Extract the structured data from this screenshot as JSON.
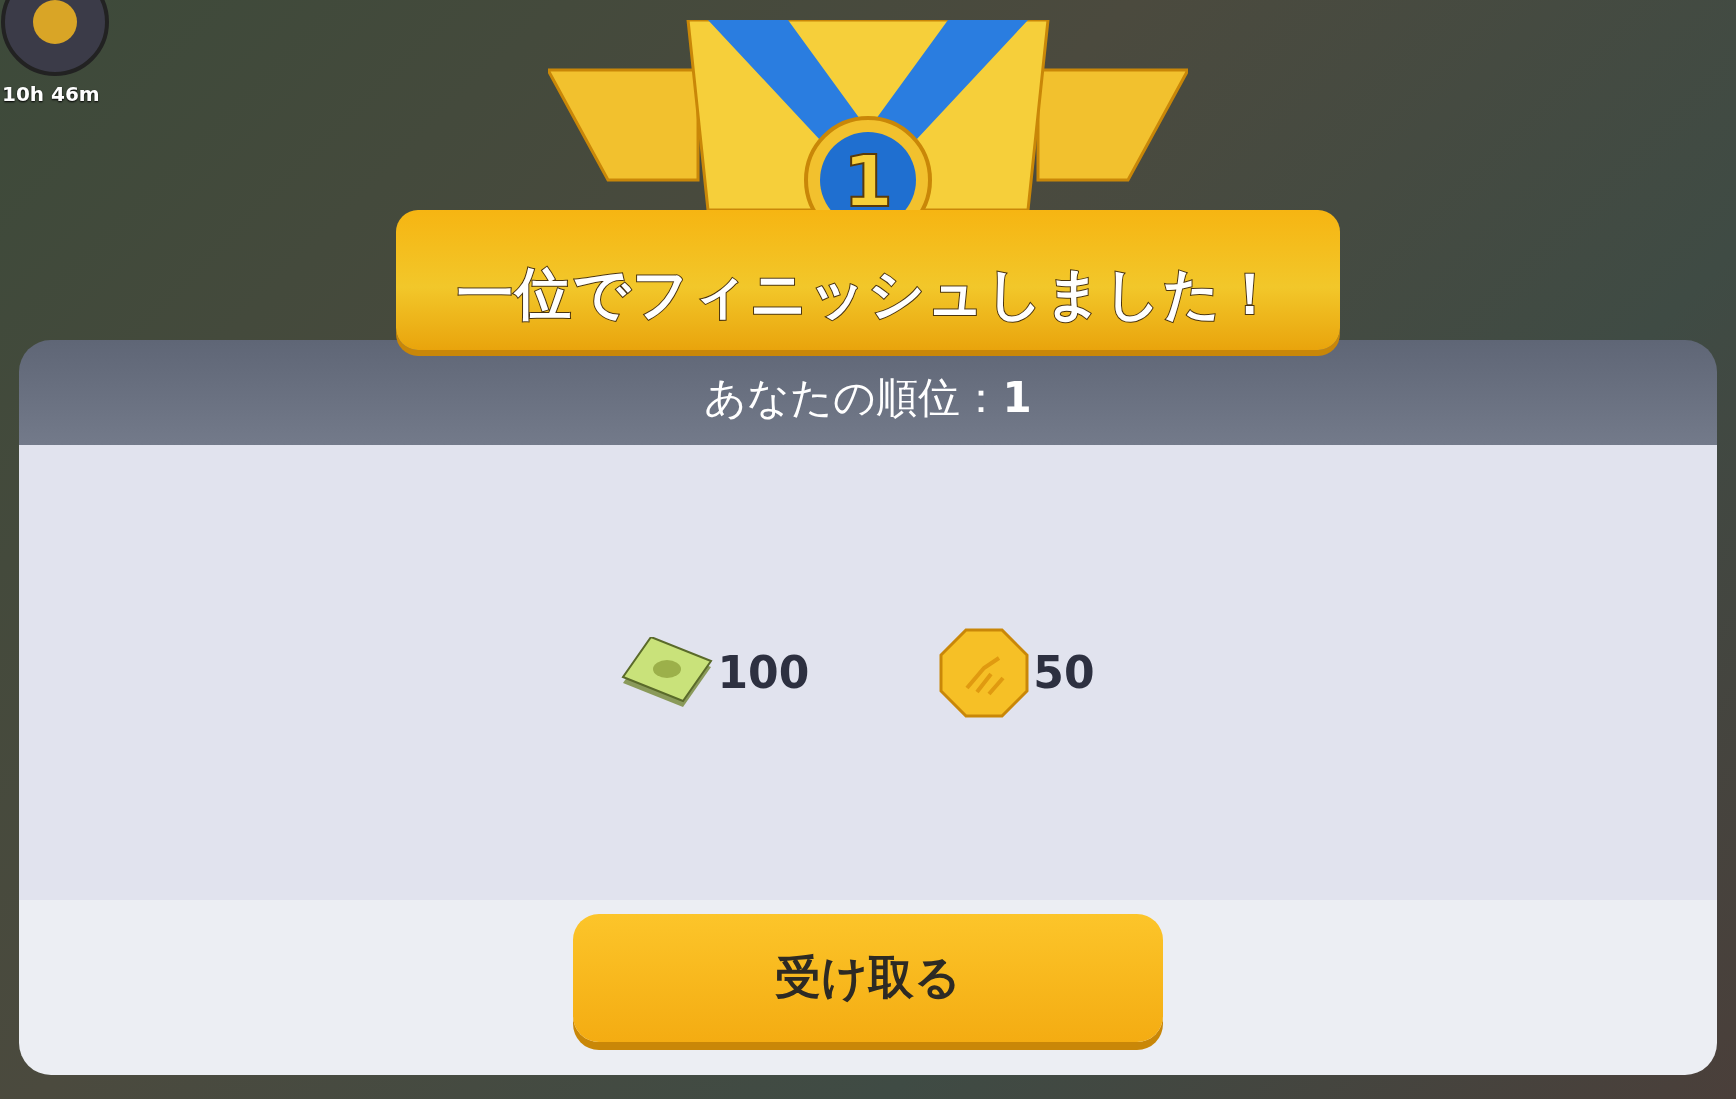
{
  "timer": {
    "text": "10h 46m"
  },
  "banner": {
    "title": "一位でフィニッシュしました！",
    "medal_number": "1"
  },
  "panel": {
    "rank_label": "あなたの順位：**1**",
    "rewards": [
      {
        "kind": "cash",
        "amount": "100"
      },
      {
        "kind": "coin",
        "amount": "50"
      }
    ],
    "button": "受け取る"
  }
}
